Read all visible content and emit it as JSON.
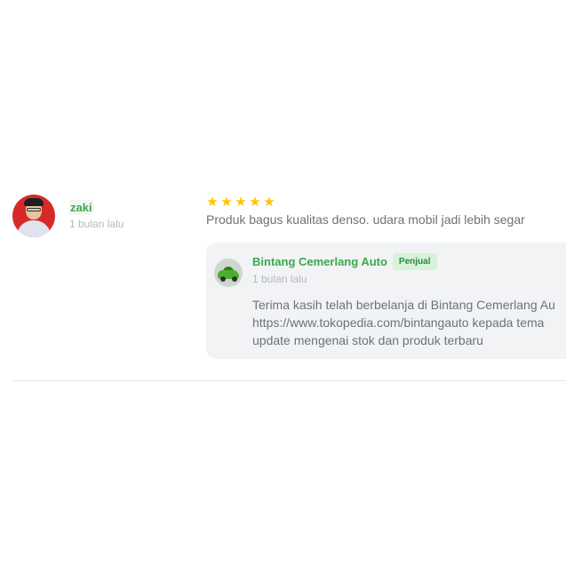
{
  "review": {
    "reviewer_name": "zaki",
    "reviewer_time": "1 bulan lalu",
    "rating": 5,
    "rating_max": 5,
    "text": "Produk bagus kualitas denso. udara mobil jadi lebih segar"
  },
  "reply": {
    "seller_name": "Bintang Cemerlang Auto",
    "badge": "Penjual",
    "time": "1 bulan lalu",
    "lines": [
      "Terima kasih telah berbelanja di Bintang Cemerlang Au",
      "https://www.tokopedia.com/bintangauto kepada tema",
      "update mengenai stok dan produk terbaru"
    ]
  },
  "colors": {
    "accent_green": "#3aa84b",
    "star": "#ffc400",
    "badge_bg": "#d6f3da",
    "avatar_bg": "#d62a2a"
  },
  "icons": {
    "star": "star-icon",
    "reviewer_avatar": "avatar",
    "seller_avatar": "seller-avatar"
  }
}
